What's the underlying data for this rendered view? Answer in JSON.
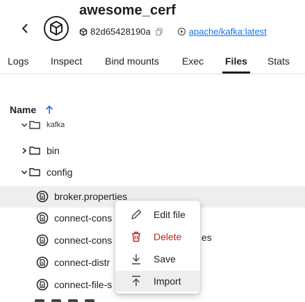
{
  "header": {
    "title": "awesome_cerf",
    "container_id": "82d65428190a",
    "image": "apache/kafka:latest"
  },
  "tabs": [
    {
      "label": "Logs",
      "active": false
    },
    {
      "label": "Inspect",
      "active": false
    },
    {
      "label": "Bind mounts",
      "active": false
    },
    {
      "label": "Exec",
      "active": false
    },
    {
      "label": "Files",
      "active": true
    },
    {
      "label": "Stats",
      "active": false
    }
  ],
  "tree": {
    "column_header": "Name",
    "partial_top": "kafka",
    "folders": [
      {
        "label": "bin",
        "expanded": false
      },
      {
        "label": "config",
        "expanded": true
      }
    ],
    "files": [
      {
        "label": "broker.properties",
        "selected": true
      },
      {
        "label": "connect-cons"
      },
      {
        "label": "connect-cons"
      },
      {
        "label": "connect-distr"
      },
      {
        "label": "connect-file-s"
      }
    ],
    "trailing_fragment": "es"
  },
  "context_menu": {
    "items": [
      {
        "label": "Edit file",
        "icon": "pencil-icon"
      },
      {
        "label": "Delete",
        "icon": "trash-icon",
        "danger": true
      },
      {
        "label": "Save",
        "icon": "download-icon"
      },
      {
        "label": "Import",
        "icon": "upload-icon",
        "hovered": true
      }
    ]
  },
  "colors": {
    "link": "#1a73e8",
    "danger": "#c5221f",
    "hover": "#eeeeee"
  }
}
